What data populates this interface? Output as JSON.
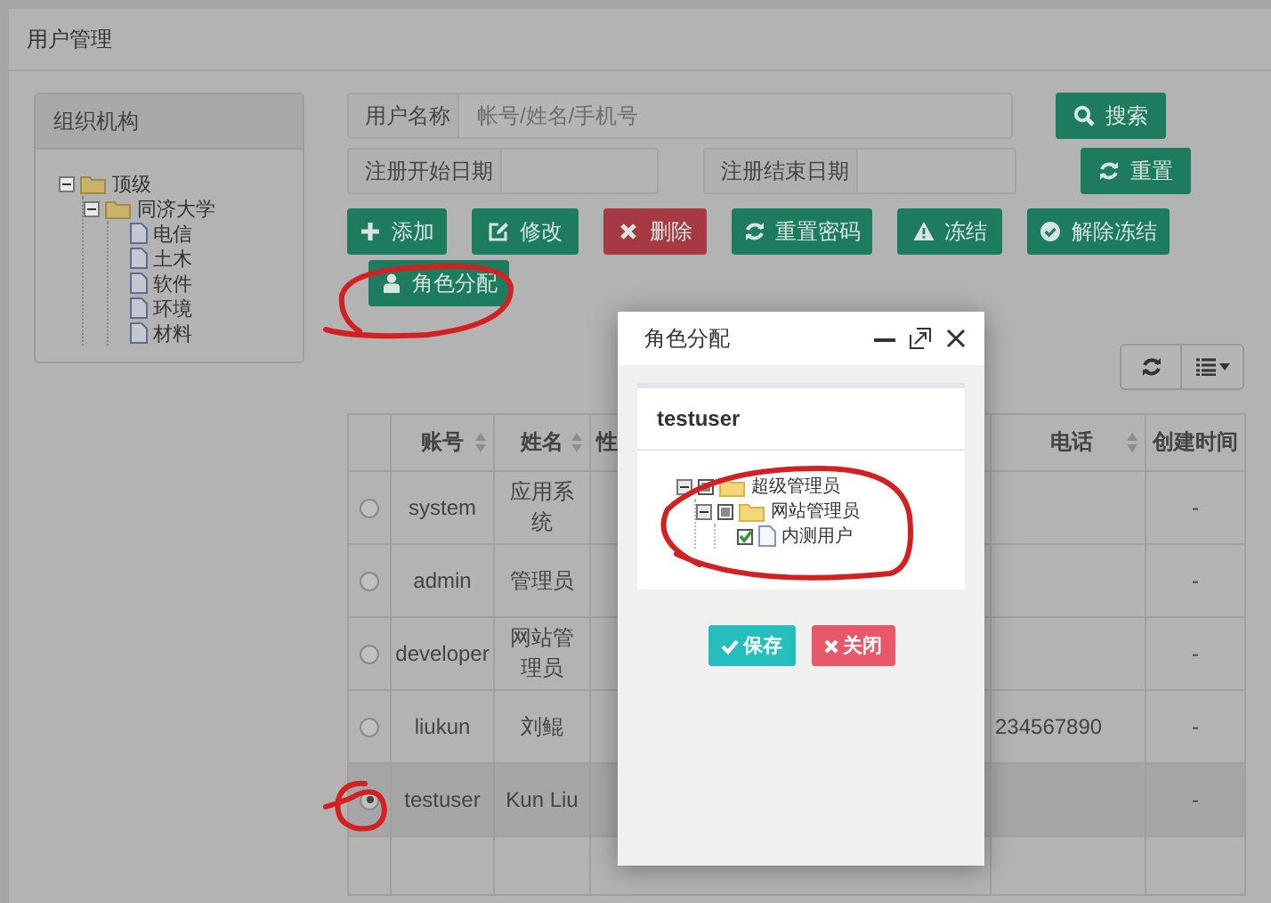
{
  "page": {
    "title": "用户管理"
  },
  "org_panel": {
    "title": "组织机构",
    "tree": [
      {
        "label": "顶级",
        "expanded": true,
        "children": [
          {
            "label": "同济大学",
            "expanded": true,
            "children": [
              {
                "label": "电信"
              },
              {
                "label": "土木"
              },
              {
                "label": "软件"
              },
              {
                "label": "环境"
              },
              {
                "label": "材料"
              }
            ]
          }
        ]
      }
    ]
  },
  "search_form": {
    "fields": [
      {
        "label": "用户名称",
        "placeholder": "帐号/姓名/手机号"
      },
      {
        "label": "注册开始日期"
      },
      {
        "label": "注册结束日期"
      }
    ],
    "buttons": [
      {
        "label": "搜索",
        "kind": "search"
      },
      {
        "label": "重置",
        "kind": "reset"
      }
    ]
  },
  "toolbar": [
    {
      "label": "添加",
      "kind": "add"
    },
    {
      "label": "修改",
      "kind": "edit"
    },
    {
      "label": "删除",
      "kind": "delete"
    },
    {
      "label": "重置密码",
      "kind": "reset"
    },
    {
      "label": "冻结",
      "kind": "freeze"
    },
    {
      "label": "解除冻结",
      "kind": "unfreeze"
    },
    {
      "label": "角色分配",
      "kind": "assign"
    }
  ],
  "table": {
    "columns": [
      {
        "label": "账号",
        "sortable": true
      },
      {
        "label": "姓名",
        "sortable": true
      },
      {
        "label": "性",
        "sortable": false
      },
      {
        "label": "电话",
        "sortable": true
      },
      {
        "label": "创建时间",
        "sortable": false
      }
    ],
    "rows": [
      {
        "selected": false,
        "account": "system",
        "name": "应用系统",
        "created": "-"
      },
      {
        "selected": false,
        "account": "admin",
        "name": "管理员",
        "created": "-"
      },
      {
        "selected": false,
        "account": "developer",
        "name": "网站管理员",
        "created": "-"
      },
      {
        "selected": false,
        "account": "liukun",
        "name": "刘鲲",
        "phone": "234567890",
        "created": "-"
      },
      {
        "selected": true,
        "account": "testuser",
        "name": "Kun Liu",
        "created": "-"
      }
    ]
  },
  "dialog": {
    "title": "角色分配",
    "user": "testuser",
    "tree": [
      {
        "label": "超级管理员",
        "expanded": true,
        "checked": false,
        "indeterminate": true,
        "children": [
          {
            "label": "网站管理员",
            "expanded": true,
            "checked": false,
            "indeterminate": true,
            "children": [
              {
                "label": "内测用户",
                "checked": true,
                "indeterminate": false
              }
            ]
          }
        ]
      }
    ],
    "buttons": [
      {
        "label": "保存",
        "kind": "save"
      },
      {
        "label": "关闭",
        "kind": "close"
      }
    ]
  }
}
